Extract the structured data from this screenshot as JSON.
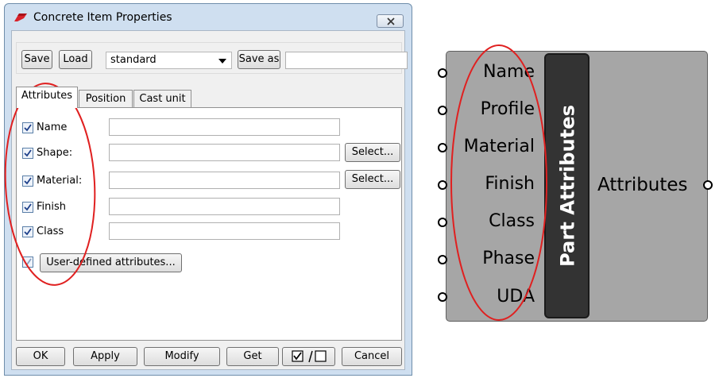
{
  "dialog": {
    "title": "Concrete Item Properties",
    "toolbar": {
      "save_label": "Save",
      "load_label": "Load",
      "preset_value": "standard",
      "save_as_label": "Save as",
      "save_as_value": ""
    },
    "tabs": [
      {
        "label": "Attributes",
        "active": true
      },
      {
        "label": "Position",
        "active": false
      },
      {
        "label": "Cast unit",
        "active": false
      }
    ],
    "rows": [
      {
        "label": "Name",
        "checked": true,
        "value": "",
        "has_select": false
      },
      {
        "label": "Shape:",
        "checked": true,
        "value": "",
        "has_select": true
      },
      {
        "label": "Material:",
        "checked": true,
        "value": "",
        "has_select": true
      },
      {
        "label": "Finish",
        "checked": true,
        "value": "",
        "has_select": false
      },
      {
        "label": "Class",
        "checked": true,
        "value": "",
        "has_select": false
      }
    ],
    "select_label": "Select...",
    "user_defined_label": "User-defined attributes...",
    "footer": {
      "ok": "OK",
      "apply": "Apply",
      "modify": "Modify",
      "get": "Get",
      "toggle": "toggle-all-checkboxes-icon",
      "cancel": "Cancel"
    }
  },
  "gh_component": {
    "title": "Part Attributes",
    "inputs": [
      "Name",
      "Profile",
      "Material",
      "Finish",
      "Class",
      "Phase",
      "UDA"
    ],
    "output": "Attributes"
  },
  "colors": {
    "annotation_red": "#e02020",
    "window_frame": "#cfdff0",
    "gh_body": "#a6a6a6",
    "gh_core": "#333333"
  }
}
